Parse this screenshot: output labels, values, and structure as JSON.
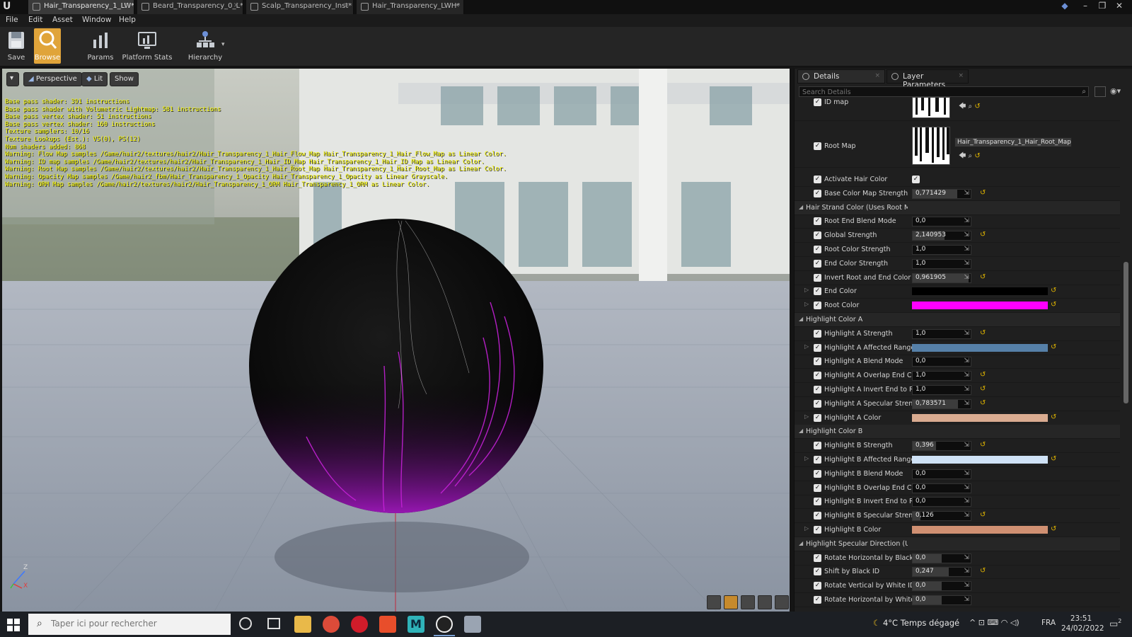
{
  "window": {
    "logo": "U",
    "tabs": [
      {
        "label": "Hair_Transparency_1_LW*",
        "active": true
      },
      {
        "label": "Beard_Transparency_0_L*",
        "active": false
      },
      {
        "label": "Scalp_Transparency_Inst*",
        "active": false
      },
      {
        "label": "Hair_Transparency_LWH*",
        "active": false
      }
    ],
    "close_glyph": "×",
    "minimize": "–",
    "maximize": "❐",
    "close": "✕"
  },
  "menu": [
    "File",
    "Edit",
    "Asset",
    "Window",
    "Help"
  ],
  "toolbar": {
    "save": "Save",
    "browse": "Browse",
    "params": "Params",
    "platform_stats": "Platform Stats",
    "hierarchy": "Hierarchy"
  },
  "viewport": {
    "dropdown": "▾",
    "perspective": "Perspective",
    "lit": "Lit",
    "show": "Show",
    "stats": [
      "Base pass shader: 391 instructions",
      "Base pass shader with Volumetric Lightmap: 581 instructions",
      "Base pass vertex shader: 51 instructions",
      "Base pass vertex shader: 160 instructions",
      "Texture samplers: 10/16",
      "Texture Lookups (Est.): VS(0), PS(12)",
      "Num shaders added: 868",
      "Warning: Flow Map samples /Game/hair2/textures/hair2/Hair_Transparency_1_Hair_Flow_Map Hair_Transparency_1_Hair_Flow_Map as Linear Color.",
      "Warning: ID map samples /Game/hair2/textures/hair2/Hair_Transparency_1_Hair_ID_Map Hair_Transparency_1_Hair_ID_Map as Linear Color.",
      "Warning: Root Map samples /Game/hair2/textures/hair2/Hair_Transparency_1_Hair_Root_Map Hair_Transparency_1_Hair_Root_Map as Linear Color.",
      "Warning: Opacity Map samples /Game/hair2_fbm/Hair_Transparency_1_Opacity Hair_Transparency_1_Opacity as Linear Grayscale.",
      "Warning: ORM Map samples /Game/hair2/textures/hair2/Hair_Transparency_1_ORM Hair_Transparency_1_ORM as Linear Color."
    ],
    "axis": {
      "z": "Z",
      "x": "X"
    }
  },
  "details": {
    "tab_details": "Details",
    "tab_layer": "Layer Parameters",
    "search_placeholder": "Search Details",
    "reset_glyph": "↺",
    "arrow_glyph": "⇲",
    "check": "✓",
    "id_map_label": "ID map",
    "root_map_label": "Root Map",
    "root_map_asset": "Hair_Transparency_1_Hair_Root_Map ▾",
    "activate_hair_color": "Activate Hair Color",
    "base_color_map_strength": {
      "label": "Base Color Map Strength",
      "value": "0,771429",
      "level": 0.77
    },
    "cat_hair_strand": "Hair Strand Color (Uses Root Map)",
    "root_end_blend": {
      "label": "Root End Blend Mode",
      "value": "0,0",
      "level": 0
    },
    "global_strength": {
      "label": "Global Strength",
      "value": "2,140953",
      "level": 0.55
    },
    "root_color_strength": {
      "label": "Root Color Strength",
      "value": "1,0",
      "level": 0
    },
    "end_color_strength": {
      "label": "End Color Strength",
      "value": "1,0",
      "level": 0
    },
    "invert_root_end": {
      "label": "Invert Root and End Color",
      "value": "0,961905",
      "level": 0.96
    },
    "end_color": {
      "label": "End Color",
      "color": "#000000"
    },
    "root_color": {
      "label": "Root Color",
      "color": "#ff00ff"
    },
    "cat_highlight_a": "Highlight Color A",
    "ha_strength": {
      "label": "Highlight A Strength",
      "value": "1,0",
      "level": 0
    },
    "ha_range": {
      "label": "Highlight A Affected Range",
      "color": "#5680a8"
    },
    "ha_blend": {
      "label": "Highlight A Blend Mode",
      "value": "0,0",
      "level": 0
    },
    "ha_overlap": {
      "label": "Highlight A Overlap End Color",
      "value": "1,0",
      "level": 0
    },
    "ha_invert": {
      "label": "Highlight A Invert End to Root",
      "value": "1,0",
      "level": 0
    },
    "ha_specular": {
      "label": "Highlight A Specular Strength",
      "value": "0,783571",
      "level": 0.78
    },
    "ha_color": {
      "label": "Highlight A Color",
      "color": "#d9ab90"
    },
    "cat_highlight_b": "Highlight Color B",
    "hb_strength": {
      "label": "Highlight B Strength",
      "value": "0,396",
      "level": 0.4
    },
    "hb_range": {
      "label": "Highlight B Affected Range",
      "color": "#cfe2f6"
    },
    "hb_blend": {
      "label": "Highlight B Blend Mode",
      "value": "0,0",
      "level": 0
    },
    "hb_overlap": {
      "label": "Highlight B Overlap End Color",
      "value": "0,0",
      "level": 0
    },
    "hb_invert": {
      "label": "Highlight B Invert End to Root",
      "value": "0,0",
      "level": 0
    },
    "hb_specular": {
      "label": "Highlight B Specular Strength",
      "value": "0,126",
      "level": 0.13
    },
    "hb_color": {
      "label": "Highlight B Color",
      "color": "#d09072"
    },
    "cat_specular_dir": "Highlight Specular Direction (Uses",
    "rot_h_black": {
      "label": "Rotate Horizontal by Black ID",
      "value": "0,0",
      "level": 0.5
    },
    "shift_black": {
      "label": "Shift by Black ID",
      "value": "0,247",
      "level": 0.62
    },
    "rot_v_white": {
      "label": "Rotate Vertical by White ID",
      "value": "0,0",
      "level": 0.5
    },
    "rot_h_white": {
      "label": "Rotate Horizontal by White ID",
      "value": "0,0",
      "level": 0.5
    }
  },
  "taskbar": {
    "search_placeholder": "Taper ici pour rechercher",
    "weather": "4°C  Temps dégagé",
    "tray": "^  ⊡  ⌨  ◠  ◁)",
    "lang": "FRA",
    "time": "23:51",
    "date": "24/02/2022",
    "notif_count": "2"
  }
}
